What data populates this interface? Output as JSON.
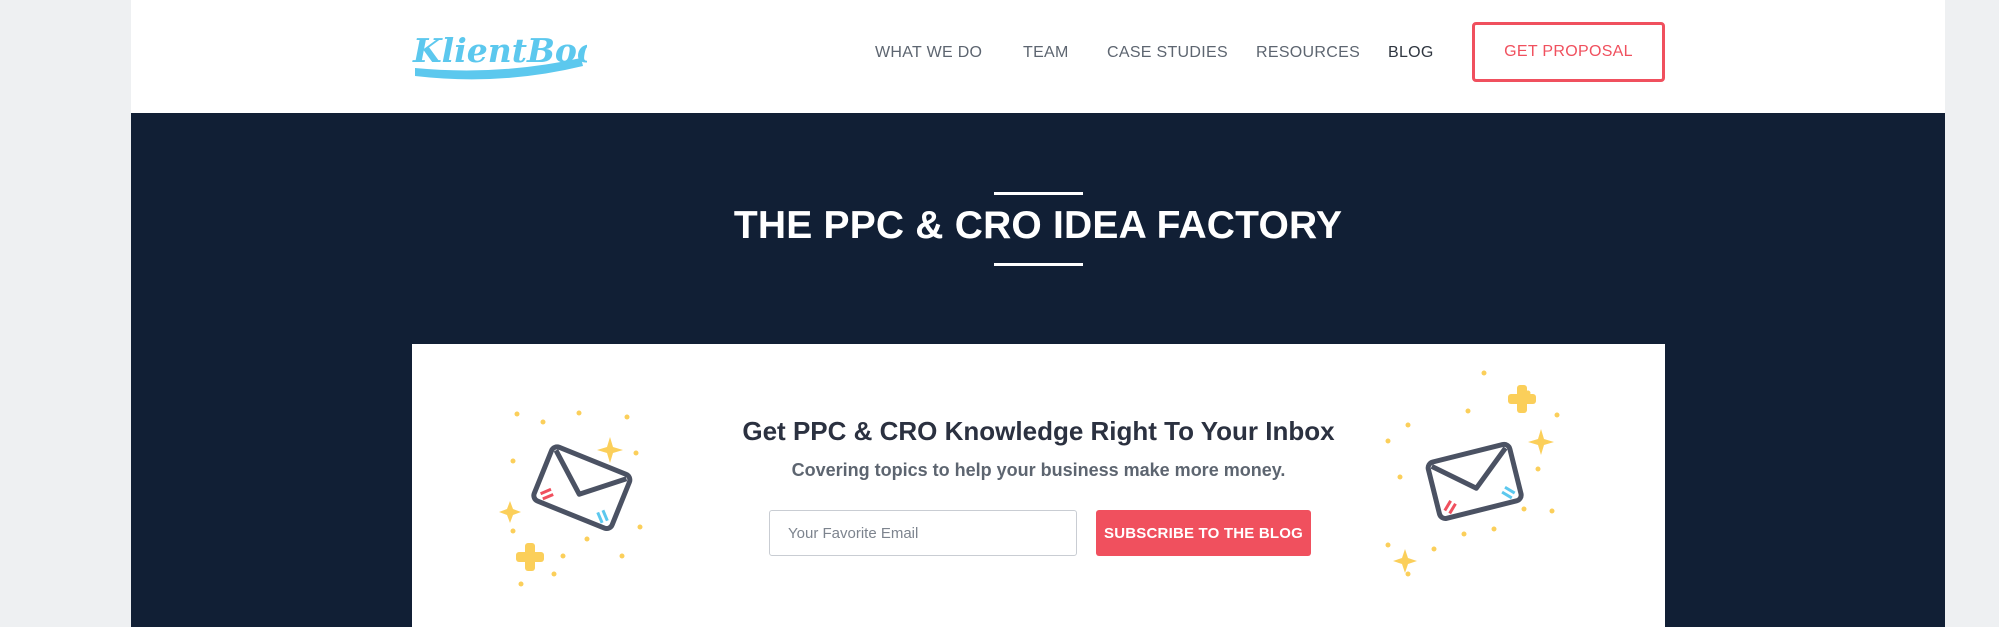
{
  "header": {
    "logo_text": "KlientBoost",
    "nav": [
      "WHAT WE DO",
      "TEAM",
      "CASE STUDIES",
      "RESOURCES",
      "BLOG"
    ],
    "active_nav": "BLOG",
    "cta_label": "GET PROPOSAL"
  },
  "hero": {
    "title": "THE PPC & CRO IDEA FACTORY"
  },
  "newsletter": {
    "title": "Get PPC & CRO Knowledge Right To Your Inbox",
    "subtitle": "Covering topics to help your business make more money.",
    "email_placeholder": "Your Favorite Email",
    "email_value": "",
    "button_label": "SUBSCRIBE TO THE BLOG"
  },
  "colors": {
    "brand": "#5cc8ee",
    "accent": "#f0505e",
    "hero_bg": "#111f35",
    "sparkle": "#fbcf5a"
  },
  "icons": {
    "logo": "klientboost-logo",
    "left_illustration": "envelope-icon",
    "right_illustration": "envelope-icon"
  }
}
